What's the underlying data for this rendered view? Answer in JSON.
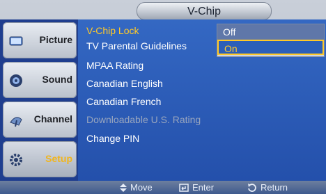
{
  "header": {
    "title": "V-Chip"
  },
  "sidebar": {
    "items": [
      {
        "label": "Picture",
        "icon": "picture-icon"
      },
      {
        "label": "Sound",
        "icon": "sound-icon"
      },
      {
        "label": "Channel",
        "icon": "channel-icon"
      },
      {
        "label": "Setup",
        "icon": "setup-icon",
        "active": true
      }
    ]
  },
  "menu": {
    "items": [
      {
        "label": "V-Chip Lock",
        "state": "selected"
      },
      {
        "label": "TV Parental Guidelines"
      },
      {
        "label": "MPAA Rating"
      },
      {
        "label": "Canadian English"
      },
      {
        "label": "Canadian French"
      },
      {
        "label": "Downloadable U.S. Rating",
        "state": "disabled"
      },
      {
        "label": "Change  PIN"
      }
    ],
    "colon": ":"
  },
  "dropdown": {
    "options": [
      {
        "label": "Off"
      },
      {
        "label": "On",
        "highlighted": true
      }
    ]
  },
  "footer": {
    "hints": [
      {
        "label": "Move",
        "icon": "move-icon"
      },
      {
        "label": "Enter",
        "icon": "enter-icon"
      },
      {
        "label": "Return",
        "icon": "return-icon"
      }
    ]
  },
  "colors": {
    "highlight": "#ffc928",
    "menu_bg": "#2c5db8"
  }
}
